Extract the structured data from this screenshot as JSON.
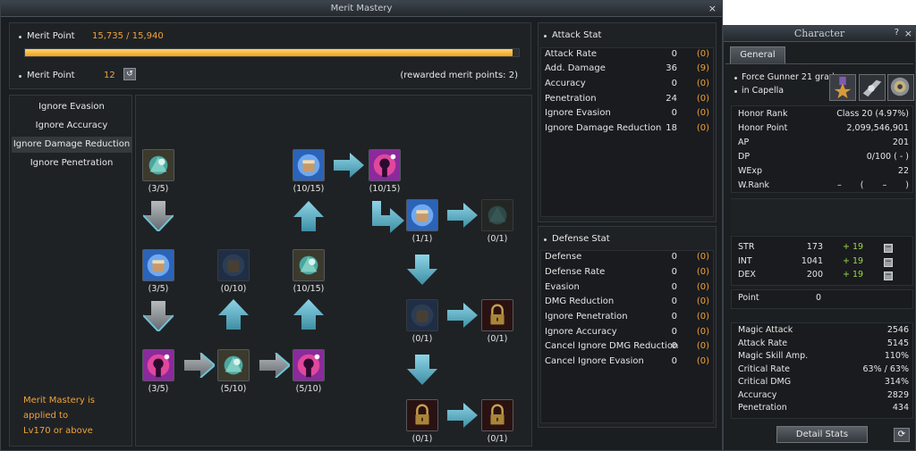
{
  "merit": {
    "title": "Merit Mastery",
    "close": "×",
    "merit_point_label": "Merit Point",
    "merit_point_value": "15,735 / 15,940",
    "progress_fraction": 0.987,
    "merit_point2_label": "Merit Point",
    "merit_point2_value": "12",
    "rewarded": "(rewarded merit points: 2)",
    "categories": [
      "Ignore Evasion",
      "Ignore Accuracy",
      "Ignore Damage Reduction",
      "Ignore Penetration"
    ],
    "note": [
      "Merit Mastery is",
      "applied to",
      "Lv170 or above"
    ],
    "nodes": [
      "(3/5)",
      "(10/15)",
      "(10/15)",
      "(1/1)",
      "(0/1)",
      "(3/5)",
      "(0/10)",
      "(10/15)",
      "(0/1)",
      "(0/1)",
      "(3/5)",
      "(5/10)",
      "(5/10)",
      "(0/1)",
      "(0/1)"
    ]
  },
  "attack_stat": {
    "title": "Attack Stat",
    "rows": [
      {
        "name": "Attack Rate",
        "value": "0",
        "bonus": "(0)"
      },
      {
        "name": "Add. Damage",
        "value": "36",
        "bonus": "(9)"
      },
      {
        "name": "Accuracy",
        "value": "0",
        "bonus": "(0)"
      },
      {
        "name": "Penetration",
        "value": "24",
        "bonus": "(0)"
      },
      {
        "name": "Ignore Evasion",
        "value": "0",
        "bonus": "(0)"
      },
      {
        "name": "Ignore Damage Reduction",
        "value": "18",
        "bonus": "(0)"
      }
    ]
  },
  "defense_stat": {
    "title": "Defense Stat",
    "rows": [
      {
        "name": "Defense",
        "value": "0",
        "bonus": "(0)"
      },
      {
        "name": "Defense Rate",
        "value": "0",
        "bonus": "(0)"
      },
      {
        "name": "Evasion",
        "value": "0",
        "bonus": "(0)"
      },
      {
        "name": "DMG Reduction",
        "value": "0",
        "bonus": "(0)"
      },
      {
        "name": "Ignore Penetration",
        "value": "0",
        "bonus": "(0)"
      },
      {
        "name": "Ignore Accuracy",
        "value": "0",
        "bonus": "(0)"
      },
      {
        "name": "Cancel Ignore DMG Reduction",
        "value": "0",
        "bonus": "(0)"
      },
      {
        "name": "Cancel Ignore Evasion",
        "value": "0",
        "bonus": "(0)"
      }
    ]
  },
  "character": {
    "title": "Character",
    "help": "?",
    "close": "×",
    "tab": "General",
    "class_line": "Force Gunner 21 grade",
    "location": "in Capella",
    "info": [
      {
        "name": "Honor Rank",
        "value": "Class 20 (4.97%)"
      },
      {
        "name": "Honor Point",
        "value": "2,099,546,901"
      },
      {
        "name": "AP",
        "value": "201"
      },
      {
        "name": "DP",
        "value": "0/100 ( - )"
      },
      {
        "name": "WExp",
        "value": "22"
      },
      {
        "name": "W.Rank",
        "value": "– ( – )"
      }
    ],
    "attributes": [
      {
        "name": "STR",
        "value": "173",
        "bonus": "+ 19"
      },
      {
        "name": "INT",
        "value": "1041",
        "bonus": "+ 19"
      },
      {
        "name": "DEX",
        "value": "200",
        "bonus": "+ 19"
      }
    ],
    "point_label": "Point",
    "point_value": "0",
    "combat": [
      {
        "name": "Magic Attack",
        "value": "2546"
      },
      {
        "name": "Attack Rate",
        "value": "5145"
      },
      {
        "name": "Magic Skill Amp.",
        "value": "110%"
      },
      {
        "name": "Critical Rate",
        "value": "63% / 63%"
      },
      {
        "name": "Critical DMG",
        "value": "314%"
      },
      {
        "name": "Accuracy",
        "value": "2829"
      },
      {
        "name": "Penetration",
        "value": "434"
      }
    ],
    "detail_button": "Detail Stats"
  },
  "colors": {
    "accent": "#f0a33a",
    "arrow": "#5fb4c9",
    "bonus_green": "#9ed64a"
  }
}
